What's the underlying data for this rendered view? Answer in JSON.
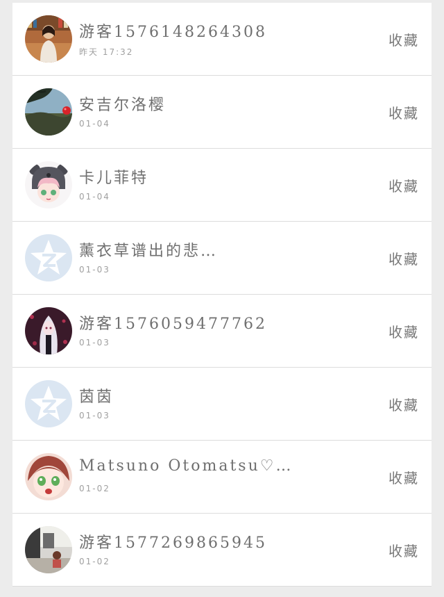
{
  "fav_label": "收藏",
  "items": [
    {
      "name": "游客1576148264308",
      "date": "昨天 17:32",
      "avatar": "photo-person-books-icon"
    },
    {
      "name": "安吉尔洛樱",
      "date": "01-04",
      "avatar": "landscape-tree-icon"
    },
    {
      "name": "卡儿菲特",
      "date": "01-04",
      "avatar": "anime-bear-hood-icon"
    },
    {
      "name": "薰衣草谱出的悲…",
      "date": "01-03",
      "avatar": "default-qzone-star-icon"
    },
    {
      "name": "游客1576059477762",
      "date": "01-03",
      "avatar": "anime-white-hair-icon"
    },
    {
      "name": "茵茵",
      "date": "01-03",
      "avatar": "default-qzone-star-icon"
    },
    {
      "name": "Matsuno Otomatsu♡…",
      "date": "01-02",
      "avatar": "anime-green-eyes-icon"
    },
    {
      "name": "游客1577269865945",
      "date": "01-02",
      "avatar": "photo-room-icon"
    }
  ]
}
